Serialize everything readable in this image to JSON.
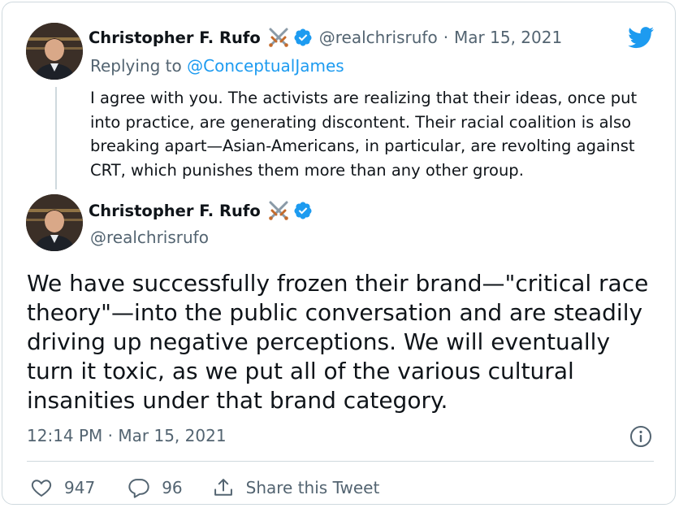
{
  "reply_tweet": {
    "author_name": "Christopher F. Rufo",
    "handle": "@realchrisrufo",
    "separator": "·",
    "date": "Mar 15, 2021",
    "replying_prefix": "Replying to",
    "replying_to": "@ConceptualJames",
    "text": "I agree with you. The activists are realizing that their ideas, once put into practice, are generating discontent. Their racial coalition is also breaking apart—Asian-Americans, in particular, are revolting against CRT, which punishes them more than any other group."
  },
  "main_tweet": {
    "author_name": "Christopher F. Rufo",
    "handle": "@realchrisrufo",
    "text": "We have successfully frozen their brand—\"critical race theory\"—into the public conversation and are steadily driving up negative perceptions. We will eventually turn it toxic, as we put all of the various cultural insanities under that brand category.",
    "timestamp": "12:14 PM · Mar 15, 2021"
  },
  "actions": {
    "likes": "947",
    "replies": "96",
    "share_label": "Share this Tweet"
  },
  "icons": {
    "logo": "twitter-bird-icon",
    "verified": "verified-badge-icon",
    "name_emoji": "crossed-swords-icon",
    "like": "heart-icon",
    "reply": "speech-bubble-icon",
    "share": "share-icon",
    "info": "info-icon"
  },
  "colors": {
    "accent": "#1d9bf0",
    "text": "#0f1419",
    "secondary": "#536471",
    "border": "#cfd9de"
  }
}
